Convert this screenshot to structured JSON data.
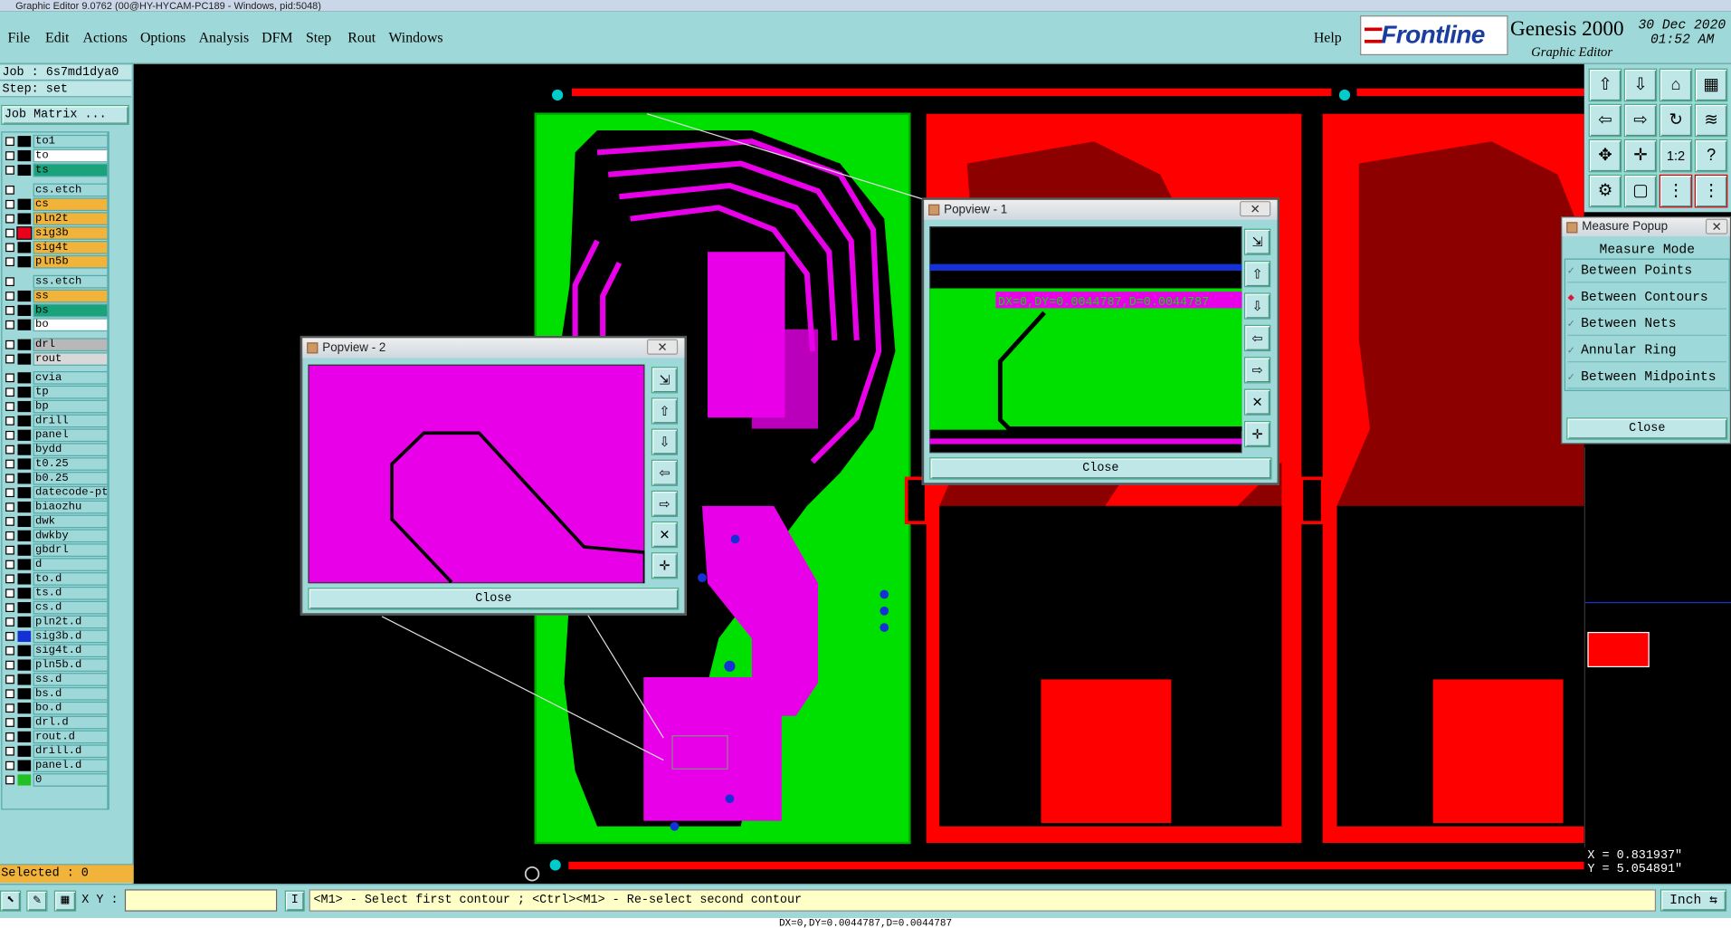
{
  "window_title": "Graphic Editor 9.0762 (00@HY-HYCAM-PC189 - Windows, pid:5048)",
  "menu": [
    "File",
    "Edit",
    "Actions",
    "Options",
    "Analysis",
    "DFM",
    "Step",
    "Rout",
    "Windows"
  ],
  "help": "Help",
  "brand": {
    "logo": "Frontline",
    "product": "Genesis 2000",
    "subtitle": "Graphic Editor",
    "date": "30 Dec 2020",
    "time": "01:52 AM"
  },
  "job": {
    "job_line": "Job : 6s7md1dya0",
    "step_line": "Step: set",
    "matrix_button": "Job Matrix ..."
  },
  "layers": [
    {
      "name": "to1",
      "sw": "#000000",
      "bg": "#9fd8d8"
    },
    {
      "name": "to",
      "sw": "#000000",
      "bg": "#ffffff"
    },
    {
      "name": "ts",
      "sw": "#000000",
      "bg": "#1aa37a"
    },
    {
      "name": "cs.etch",
      "sw": "#9fd8d8",
      "bg": "#9fd8d8"
    },
    {
      "name": "cs",
      "sw": "#000000",
      "bg": "#f2b33b"
    },
    {
      "name": "pln2t",
      "sw": "#000000",
      "bg": "#f2b33b"
    },
    {
      "name": "sig3b",
      "sw": "#e8001c",
      "bg": "#f2b33b",
      "sel": true
    },
    {
      "name": "sig4t",
      "sw": "#000000",
      "bg": "#f2b33b"
    },
    {
      "name": "pln5b",
      "sw": "#000000",
      "bg": "#f2b33b"
    },
    {
      "name": "ss.etch",
      "sw": "#9fd8d8",
      "bg": "#9fd8d8"
    },
    {
      "name": "ss",
      "sw": "#000000",
      "bg": "#f2b33b"
    },
    {
      "name": "bs",
      "sw": "#000000",
      "bg": "#1aa37a"
    },
    {
      "name": "bo",
      "sw": "#000000",
      "bg": "#ffffff"
    },
    {
      "name": "drl",
      "sw": "#000000",
      "bg": "#b8b8b8"
    },
    {
      "name": "rout",
      "sw": "#000000",
      "bg": "#d8d8d8"
    },
    {
      "name": "cvia",
      "sw": "#000000",
      "bg": "#9fd8d8"
    },
    {
      "name": "tp",
      "sw": "#000000",
      "bg": "#9fd8d8"
    },
    {
      "name": "bp",
      "sw": "#000000",
      "bg": "#9fd8d8"
    },
    {
      "name": "drill",
      "sw": "#000000",
      "bg": "#9fd8d8"
    },
    {
      "name": "panel",
      "sw": "#000000",
      "bg": "#9fd8d8"
    },
    {
      "name": "bydd",
      "sw": "#000000",
      "bg": "#9fd8d8"
    },
    {
      "name": "t0.25",
      "sw": "#000000",
      "bg": "#9fd8d8"
    },
    {
      "name": "b0.25",
      "sw": "#000000",
      "bg": "#9fd8d8"
    },
    {
      "name": "datecode-pte",
      "sw": "#000000",
      "bg": "#9fd8d8"
    },
    {
      "name": "biaozhu",
      "sw": "#000000",
      "bg": "#9fd8d8"
    },
    {
      "name": "dwk",
      "sw": "#000000",
      "bg": "#9fd8d8"
    },
    {
      "name": "dwkby",
      "sw": "#000000",
      "bg": "#9fd8d8"
    },
    {
      "name": "gbdrl",
      "sw": "#000000",
      "bg": "#9fd8d8"
    },
    {
      "name": "d",
      "sw": "#000000",
      "bg": "#9fd8d8"
    },
    {
      "name": "to.d",
      "sw": "#000000",
      "bg": "#9fd8d8"
    },
    {
      "name": "ts.d",
      "sw": "#000000",
      "bg": "#9fd8d8"
    },
    {
      "name": "cs.d",
      "sw": "#000000",
      "bg": "#9fd8d8"
    },
    {
      "name": "pln2t.d",
      "sw": "#000000",
      "bg": "#9fd8d8"
    },
    {
      "name": "sig3b.d",
      "sw": "#1531d6",
      "bg": "#9fd8d8"
    },
    {
      "name": "sig4t.d",
      "sw": "#000000",
      "bg": "#9fd8d8"
    },
    {
      "name": "pln5b.d",
      "sw": "#000000",
      "bg": "#9fd8d8"
    },
    {
      "name": "ss.d",
      "sw": "#000000",
      "bg": "#9fd8d8"
    },
    {
      "name": "bs.d",
      "sw": "#000000",
      "bg": "#9fd8d8"
    },
    {
      "name": "bo.d",
      "sw": "#000000",
      "bg": "#9fd8d8"
    },
    {
      "name": "drl.d",
      "sw": "#000000",
      "bg": "#9fd8d8"
    },
    {
      "name": "rout.d",
      "sw": "#000000",
      "bg": "#9fd8d8"
    },
    {
      "name": "drill.d",
      "sw": "#000000",
      "bg": "#9fd8d8"
    },
    {
      "name": "panel.d",
      "sw": "#000000",
      "bg": "#9fd8d8"
    },
    {
      "name": "0",
      "sw": "#22c022",
      "bg": "#9fd8d8"
    }
  ],
  "selected_label": "Selected : 0",
  "status": {
    "xy_label": "X Y :",
    "xy_value": "",
    "message": "<M1> - Select first contour ; <Ctrl><M1> - Re-select second contour",
    "unit": "Inch",
    "bottom_text": "DX=0,DY=0.0044787,D=0.0044787"
  },
  "popview1": {
    "title": "Popview - 1",
    "measure_text": "DX=0,DY=0.0044787,D=0.0044787",
    "close": "Close"
  },
  "popview2": {
    "title": "Popview - 2",
    "close": "Close"
  },
  "measure_popup": {
    "title": "Measure Popup",
    "header": "Measure Mode",
    "modes": [
      "Between Points",
      "Between Contours",
      "Between Nets",
      "Annular Ring",
      "Between Midpoints"
    ],
    "selected_mode": "Between Contours",
    "close": "Close"
  },
  "coords": {
    "x": "X = 0.831937\"",
    "y": "Y = 5.054891\""
  },
  "colors": {
    "panel": "#9fd8d8",
    "board_green": "#00e000",
    "board_red": "#ff0000",
    "highlight": "#e800e8",
    "blue": "#1531d6"
  }
}
